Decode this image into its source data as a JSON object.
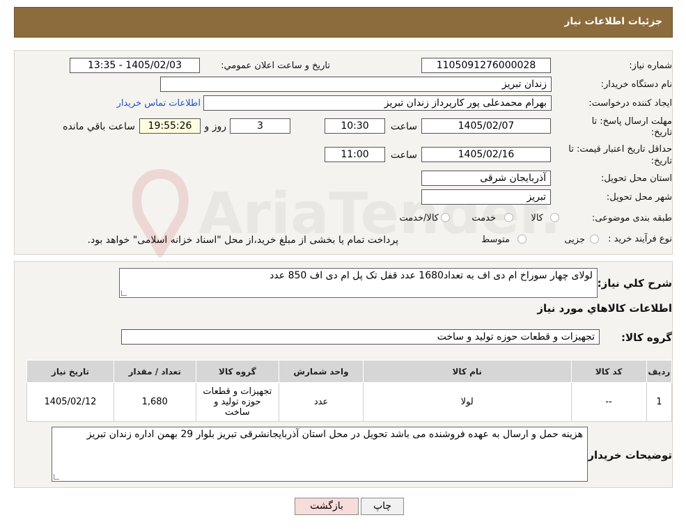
{
  "header": {
    "title": "جزئیات اطلاعات نیاز"
  },
  "form": {
    "need_number_label": "شماره نیاز:",
    "need_number": "1105091276000028",
    "announce_label": "تاریخ و ساعت اعلان عمومي:",
    "announce_value": "1405/02/03 - 13:35",
    "buyer_org_label": "نام دستگاه خريدار:",
    "buyer_org": "زندان تبریز",
    "creator_label": "ايجاد كننده درخواست:",
    "creator": "بهرام محمدعلی پور کارپرداز زندان تبریز",
    "contact_link": "اطلاعات تماس خريدار",
    "deadline_label_line1": "مهلت ارسال پاسخ: تا",
    "deadline_label_line2": "تاريخ:",
    "deadline_date": "1405/02/07",
    "time_label": "ساعت",
    "deadline_time": "10:30",
    "days_value": "3",
    "days_label": "روز و",
    "remaining_time": "19:55:26",
    "remaining_label": "ساعت باقي مانده",
    "validity_label_line1": "حداقل تاريخ اعتبار قيمت: تا",
    "validity_label_line2": "تاريخ:",
    "validity_date": "1405/02/16",
    "validity_time_label": "ساعت",
    "validity_time": "11:00",
    "province_label": "استان محل تحويل:",
    "province": "آذربایجان شرقی",
    "city_label": "شهر محل تحويل:",
    "city": "تبریز",
    "category_label": "طبقه بندی موضوعی:",
    "category_options": [
      "کالا",
      "خدمت",
      "کالا/خدمت"
    ],
    "process_label": "نوع فرآيند خريد :",
    "process_options": [
      "جزیی",
      "متوسط"
    ],
    "process_note": "پرداخت تمام یا بخشی از مبلغ خرید،از محل \"اسناد خزانه اسلامی\" خواهد بود."
  },
  "description": {
    "label": "شرح كلي نياز:",
    "text": "لولای  چهار سوراخ ام دی اف به تعداد1680 عدد قفل تک پل ام دی اف 850 عدد"
  },
  "goods_section": {
    "title": "اطلاعات كالاهاي مورد نياز",
    "group_label": "گروه كالا:",
    "group_value": "تجهیزات و قطعات حوزه تولید و ساخت"
  },
  "table": {
    "headers": [
      "رديف",
      "كد كالا",
      "نام كالا",
      "واحد شمارش",
      "گروه كالا",
      "تعداد / مقدار",
      "تاريخ نياز"
    ],
    "rows": [
      [
        "1",
        "--",
        "لولا",
        "عدد",
        "تجهیزات و قطعات حوزه تولید و ساخت",
        "1,680",
        "1405/02/12"
      ]
    ]
  },
  "buyer_notes": {
    "label": "توضيحات خريدار:",
    "text": "هزینه حمل و ارسال به عهده فروشنده می باشد تحویل در محل استان آذربایجانشرقی تبریز بلوار 29 بهمن اداره زندان تبریز"
  },
  "buttons": {
    "print": "چاپ",
    "back": "بازگشت"
  },
  "watermark": {
    "text": "AriaTender.neT"
  },
  "colors": {
    "header_bg": "#8c6c3c",
    "link": "#1a55c4",
    "back_button_bg": "#f7dcdc",
    "yellow_box": "#fffde0"
  }
}
